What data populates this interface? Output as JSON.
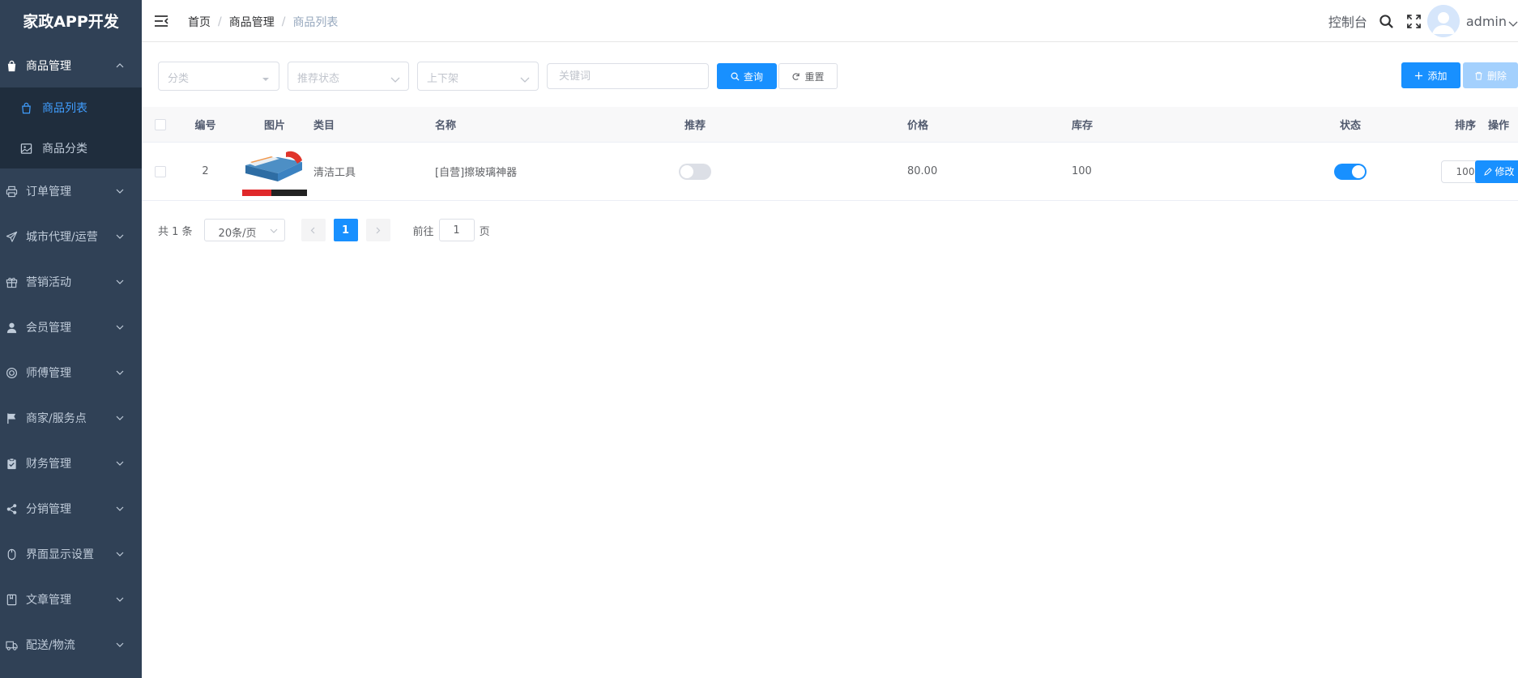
{
  "app": {
    "title": "家政APP开发"
  },
  "sidebar": {
    "groups": [
      {
        "label": "商品管理",
        "icon": "shopping-bag-icon",
        "open": true,
        "children": [
          {
            "label": "商品列表",
            "icon": "bag-outline-icon",
            "active": true
          },
          {
            "label": "商品分类",
            "icon": "picture-icon",
            "active": false
          }
        ]
      },
      {
        "label": "订单管理",
        "icon": "printer-icon"
      },
      {
        "label": "城市代理/运营",
        "icon": "send-icon"
      },
      {
        "label": "营销活动",
        "icon": "gift-icon"
      },
      {
        "label": "会员管理",
        "icon": "user-icon"
      },
      {
        "label": "师傅管理",
        "icon": "lifebuoy-icon"
      },
      {
        "label": "商家/服务点",
        "icon": "flag-icon"
      },
      {
        "label": "财务管理",
        "icon": "clipboard-check-icon"
      },
      {
        "label": "分销管理",
        "icon": "share-icon"
      },
      {
        "label": "界面显示设置",
        "icon": "mouse-icon"
      },
      {
        "label": "文章管理",
        "icon": "notebook-icon"
      },
      {
        "label": "配送/物流",
        "icon": "truck-icon"
      }
    ]
  },
  "navbar": {
    "breadcrumb": [
      "首页",
      "商品管理",
      "商品列表"
    ],
    "console_label": "控制台",
    "username": "admin"
  },
  "filters": {
    "category_placeholder": "分类",
    "recommend_placeholder": "推荐状态",
    "shelf_placeholder": "上下架",
    "keyword_placeholder": "关键词",
    "search_label": "查询",
    "reset_label": "重置",
    "add_label": "添加",
    "delete_label": "删除"
  },
  "table": {
    "headers": {
      "id": "编号",
      "image": "图片",
      "category": "类目",
      "name": "名称",
      "recommend": "推荐",
      "price": "价格",
      "stock": "库存",
      "status": "状态",
      "sort": "排序",
      "actions": "操作"
    },
    "rows": [
      {
        "id": "2",
        "category": "清洁工具",
        "name": "[自营]擦玻璃神器",
        "recommend": false,
        "price": "80.00",
        "stock": "100",
        "status": true,
        "sort": "100",
        "edit_label": "修改"
      }
    ]
  },
  "pagination": {
    "total_text": "共 1 条",
    "page_size": "20条/页",
    "current_page": "1",
    "goto_prefix": "前往",
    "goto_value": "1",
    "goto_suffix": "页"
  },
  "colors": {
    "sidebar_bg": "#304156",
    "submenu_bg": "#1f2d3d",
    "accent": "#1890ff",
    "active_text": "#409eff"
  }
}
